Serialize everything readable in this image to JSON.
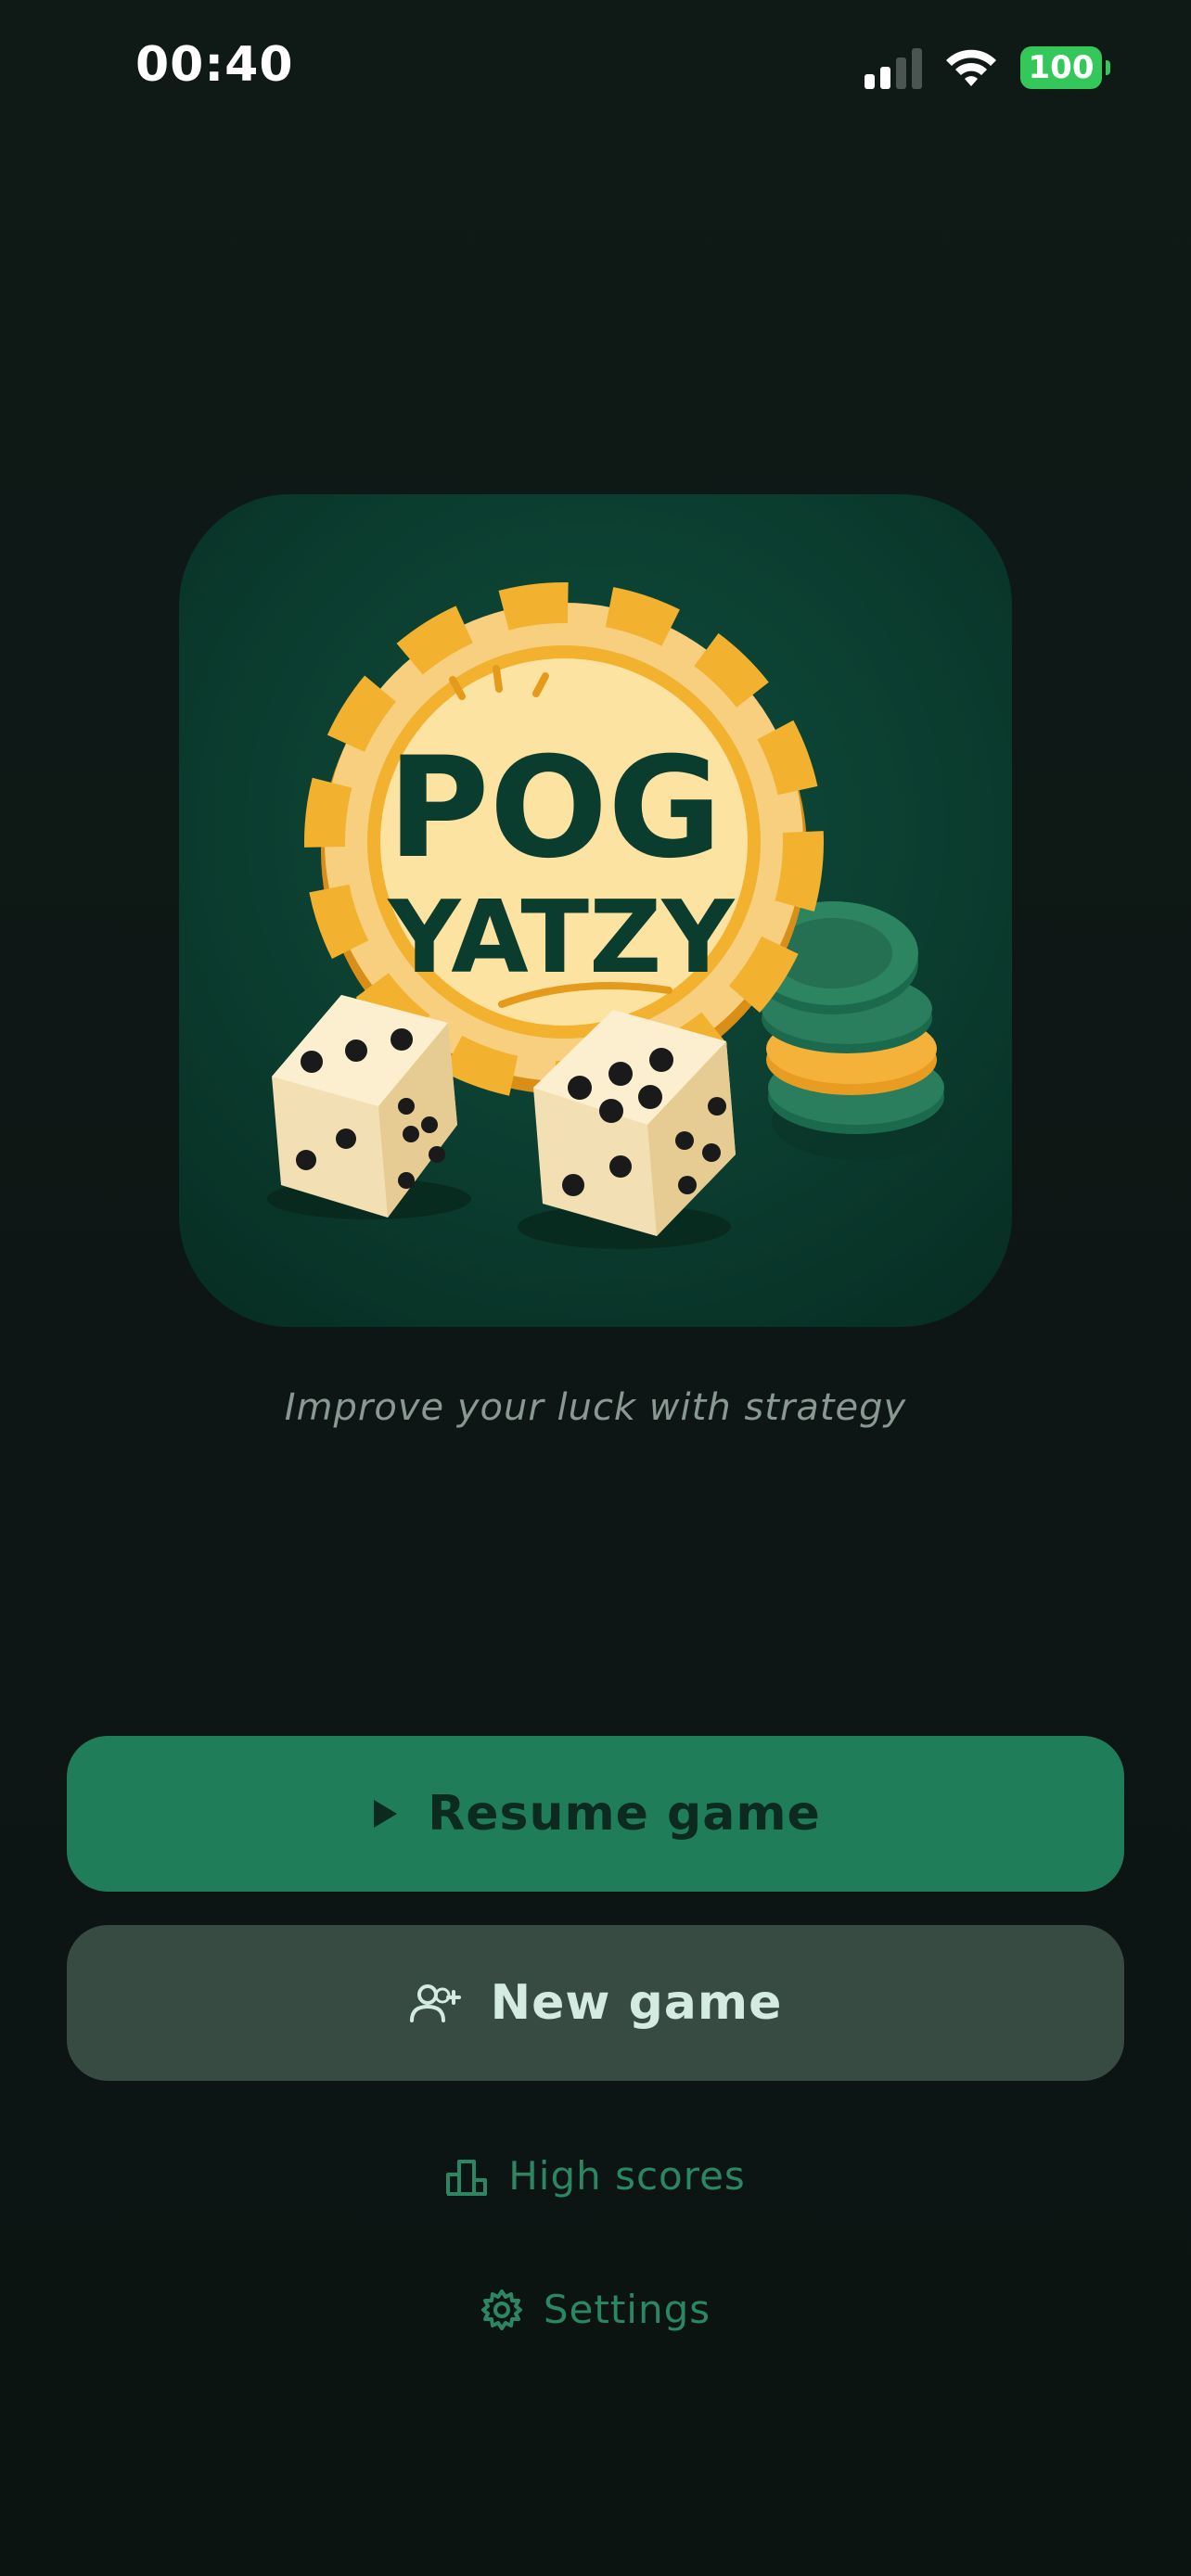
{
  "status_bar": {
    "time": "00:40",
    "battery": "100"
  },
  "logo": {
    "line1": "POG",
    "line2": "YATZY"
  },
  "tagline": "Improve your luck with strategy",
  "buttons": {
    "resume": "Resume game",
    "new_game": "New game"
  },
  "links": {
    "high_scores": "High scores",
    "settings": "Settings"
  },
  "colors": {
    "background": "#0f1816",
    "primary": "#1f7d59",
    "secondary": "#374b43",
    "accent_text": "#2a8762",
    "chip_gold": "#f2b12e",
    "logo_text": "#0b3d2f"
  },
  "icons": {
    "resume": "play-icon",
    "new_game": "add-user-icon",
    "high_scores": "podium-icon",
    "settings": "gear-icon"
  }
}
